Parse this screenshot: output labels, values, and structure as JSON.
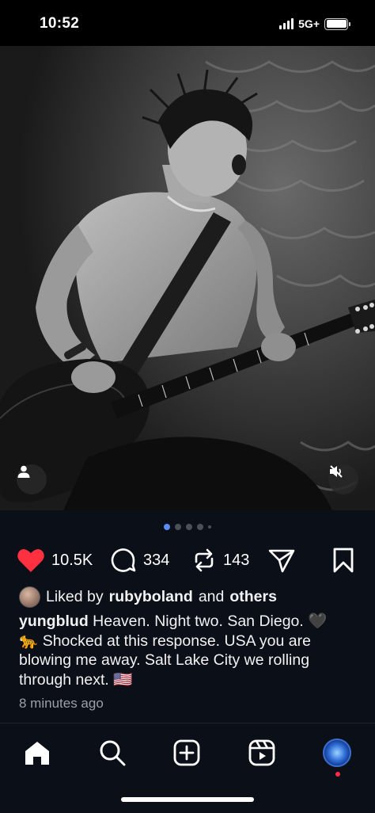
{
  "status_bar": {
    "time": "10:52",
    "network": "5G+",
    "icons": [
      "signal-icon",
      "battery-icon"
    ]
  },
  "post": {
    "media_dots": {
      "count": 5,
      "active_index": 0
    },
    "image_icons": [
      "user-tag-icon",
      "mute-icon"
    ],
    "actions": {
      "likes": "10.5K",
      "comments": "334",
      "reposts": "143",
      "liked": true,
      "icons": [
        "heart-icon",
        "comment-icon",
        "repost-icon",
        "share-icon",
        "bookmark-icon"
      ]
    },
    "liked_by": {
      "prefix": "Liked by",
      "user": "rubyboland",
      "conjunction": "and",
      "others": "others"
    },
    "caption": {
      "username": "yungblud",
      "line1": "Heaven. Night two. San Diego. 🖤",
      "line2": "🐆 Shocked at this response. USA you are",
      "line3": "blowing me away. Salt Lake City we rolling",
      "line4": "through next. 🇺🇸"
    },
    "timestamp": "8 minutes ago"
  },
  "bottom_nav": {
    "items": [
      "home-icon",
      "search-icon",
      "create-icon",
      "reels-icon",
      "profile-avatar"
    ],
    "active": "home-icon"
  },
  "colors": {
    "background": "#0b0f18",
    "like_red": "#ff3040",
    "dot_active": "#5b8df5",
    "notification": "#ff2d45"
  }
}
